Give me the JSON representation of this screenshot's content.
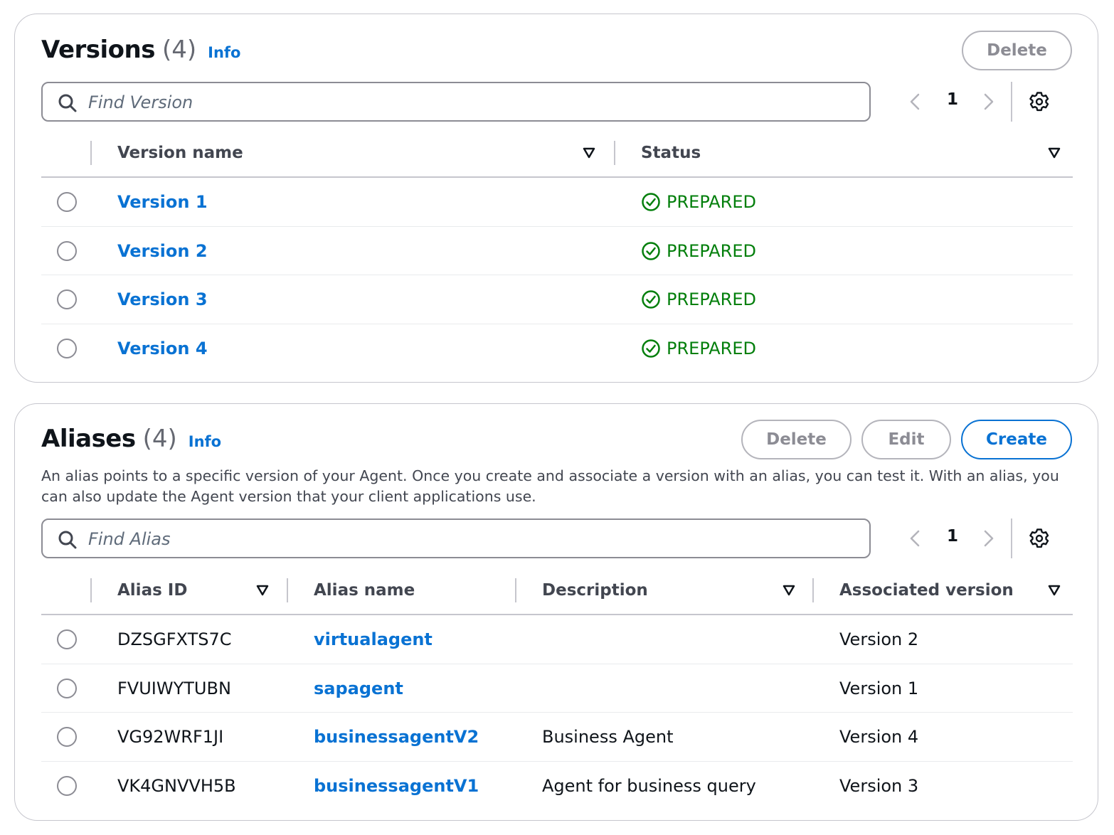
{
  "versions": {
    "title": "Versions",
    "count": "(4)",
    "info": "Info",
    "delete_label": "Delete",
    "search_placeholder": "Find Version",
    "page": "1",
    "columns": {
      "name": "Version name",
      "status": "Status"
    },
    "rows": [
      {
        "name": "Version 1",
        "status": "PREPARED"
      },
      {
        "name": "Version 2",
        "status": "PREPARED"
      },
      {
        "name": "Version 3",
        "status": "PREPARED"
      },
      {
        "name": "Version 4",
        "status": "PREPARED"
      }
    ]
  },
  "aliases": {
    "title": "Aliases",
    "count": "(4)",
    "info": "Info",
    "delete_label": "Delete",
    "edit_label": "Edit",
    "create_label": "Create",
    "description": "An alias points to a specific version of your Agent. Once you create and associate a version with an alias, you can test it. With an alias, you can also update the Agent version that your client applications use.",
    "search_placeholder": "Find Alias",
    "page": "1",
    "columns": {
      "id": "Alias ID",
      "name": "Alias name",
      "description": "Description",
      "version": "Associated version"
    },
    "rows": [
      {
        "id": "DZSGFXTS7C",
        "name": "virtualagent",
        "description": "",
        "version": "Version 2"
      },
      {
        "id": "FVUIWYTUBN",
        "name": "sapagent",
        "description": "",
        "version": "Version 1"
      },
      {
        "id": "VG92WRF1JI",
        "name": "businessagentV2",
        "description": "Business Agent",
        "version": "Version 4"
      },
      {
        "id": "VK4GNVVH5B",
        "name": "businessagentV1",
        "description": "Agent for business query",
        "version": "Version 3"
      }
    ]
  },
  "colors": {
    "link": "#0972d3",
    "success": "#037f0c",
    "border": "#c6c6cd",
    "disabled": "#8c8c94"
  },
  "icons": [
    "search-icon",
    "chevron-left-icon",
    "chevron-right-icon",
    "gear-icon",
    "sort-caret-icon",
    "check-circle-icon"
  ]
}
